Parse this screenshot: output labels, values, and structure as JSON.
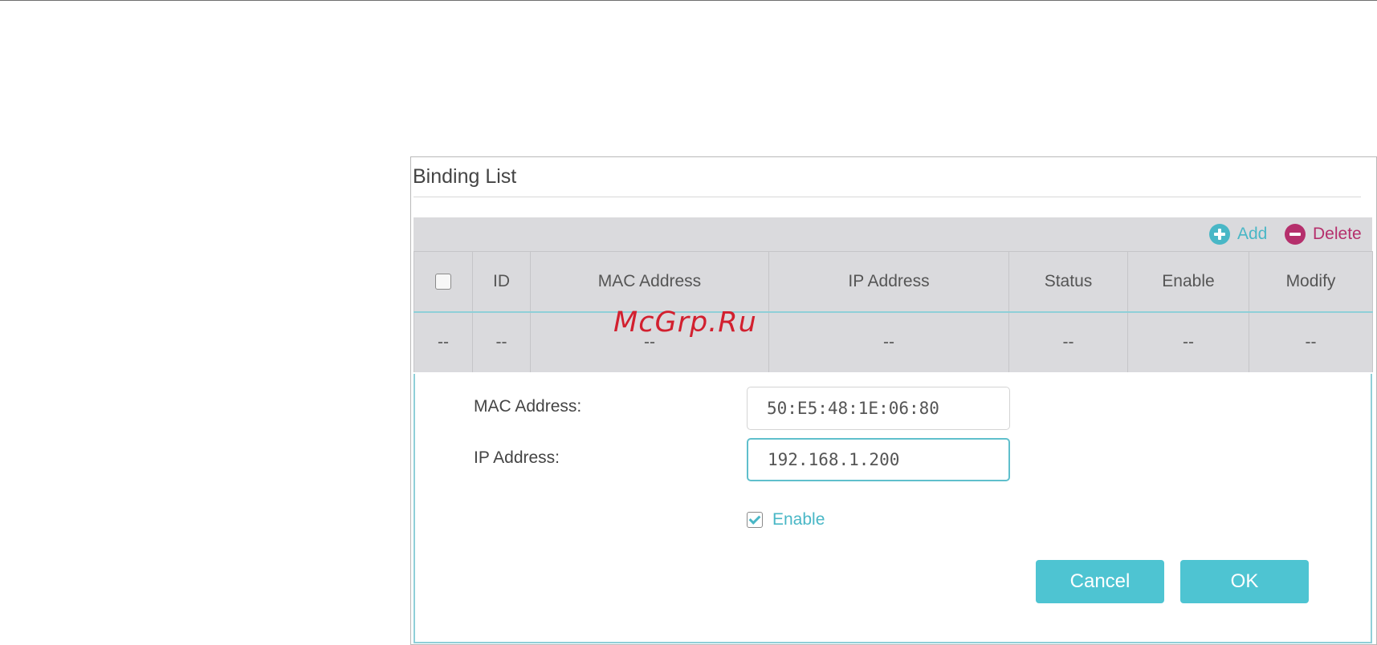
{
  "panel": {
    "title": "Binding List"
  },
  "toolbar": {
    "add_label": "Add",
    "delete_label": "Delete",
    "add_icon": "plus-circle-icon",
    "delete_icon": "minus-circle-icon"
  },
  "table": {
    "columns": [
      "ID",
      "MAC Address",
      "IP Address",
      "Status",
      "Enable",
      "Modify"
    ],
    "rows": [
      [
        "--",
        "--",
        "--",
        "--",
        "--",
        "--",
        "--"
      ]
    ]
  },
  "form": {
    "mac_label": "MAC Address:",
    "mac_value": "50:E5:48:1E:06:80",
    "ip_label": "IP Address:",
    "ip_value": "192.168.1.200",
    "enable_label": "Enable",
    "enable_checked": true,
    "cancel_label": "Cancel",
    "ok_label": "OK"
  },
  "watermark": "McGrp.Ru",
  "colors": {
    "accent": "#4ec4d2",
    "delete": "#b52f6c",
    "table_bg": "#dadadd"
  }
}
